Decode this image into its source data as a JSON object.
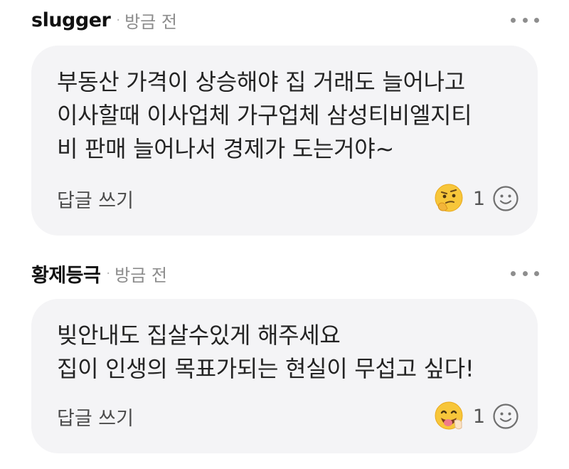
{
  "comments": [
    {
      "author": "slugger",
      "separator": "·",
      "time": "방금 전",
      "text": "부동산 가격이 상승해야 집 거래도 늘어나고\n이사할때 이사업체 가구업체 삼성티비엘지티\n비 판매 늘어나서 경제가 도는거야~",
      "reply_label": "답글 쓰기",
      "reaction_icon": "thinking-face-icon",
      "reaction_count": "1"
    },
    {
      "author": "황제등극",
      "separator": "·",
      "time": "방금 전",
      "text": "빚안내도 집살수있게 해주세요\n집이 인생의 목표가되는 현실이 무섭고 싶다!",
      "reply_label": "답글 쓰기",
      "reaction_icon": "tongue-face-icon",
      "reaction_count": "1"
    }
  ],
  "colors": {
    "bubble_bg": "#f4f4f6",
    "emoji_yellow": "#f7c63a",
    "muted_text": "#8c8c8c"
  }
}
